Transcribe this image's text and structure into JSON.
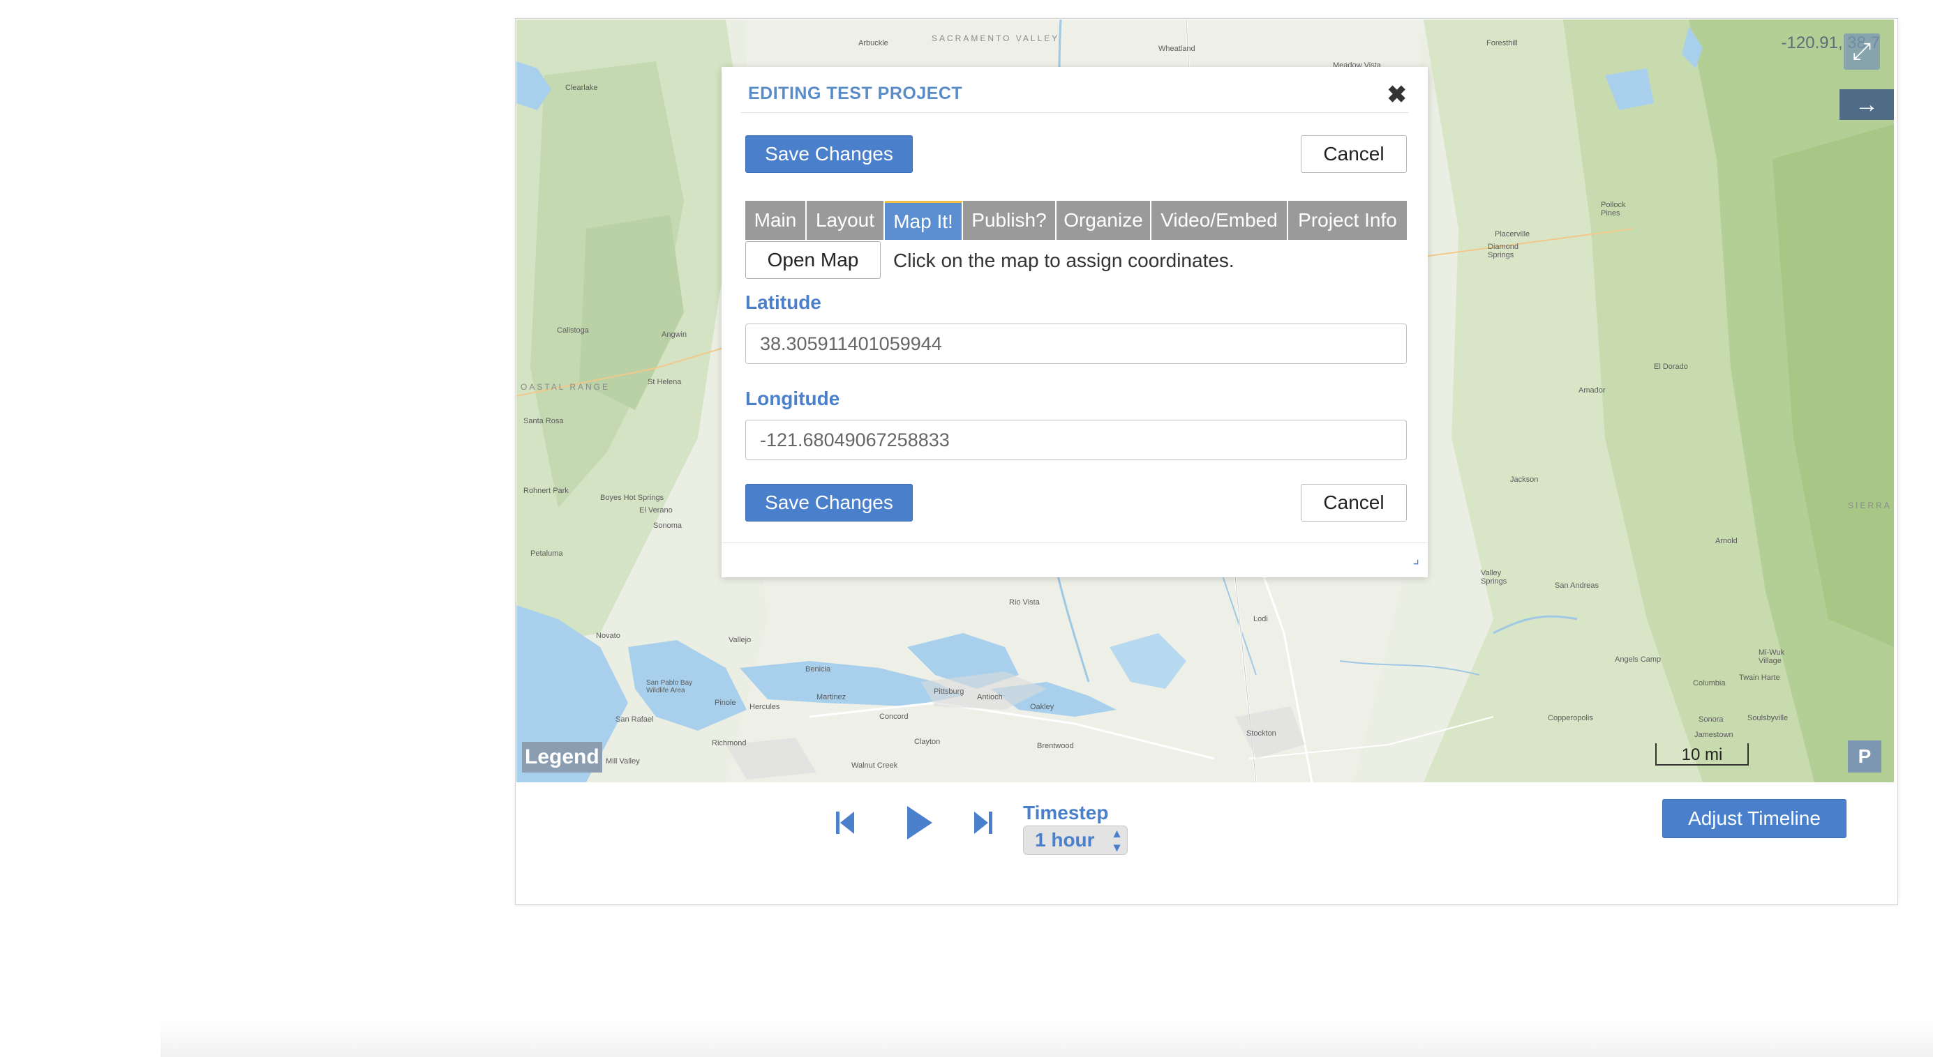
{
  "map": {
    "coordinate_readout": "-120.91, 38.7",
    "legend_label": "Legend",
    "p_label": "P",
    "scale_label": "10 mi",
    "labels": {
      "sacramento_valley": "SACRAMENTO VALLEY",
      "coast_range": "OASTAL RANGE",
      "arbuckle": "Arbuckle",
      "wheatland": "Wheatland",
      "foresthill": "Foresthill",
      "clearlake": "Clearlake",
      "meadow_vista": "Meadow Vista",
      "calistoga": "Calistoga",
      "angwin": "Angwin",
      "st_helena": "St Helena",
      "santa_rosa": "Santa Rosa",
      "rohnert_park": "Rohnert Park",
      "boyes_hot_springs": "Boyes Hot Springs",
      "el_verano": "El Verano",
      "sonoma": "Sonoma",
      "petaluma": "Petaluma",
      "novato": "Novato",
      "vallejo": "Vallejo",
      "benicia": "Benicia",
      "san_pablo_bay": "San Pablo Bay Wildlife Area",
      "pinole": "Pinole",
      "hercules": "Hercules",
      "martinez": "Martinez",
      "concord": "Concord",
      "pittsburg": "Pittsburg",
      "antioch": "Antioch",
      "oakley": "Oakley",
      "brentwood": "Brentwood",
      "clayton": "Clayton",
      "richmond": "Richmond",
      "san_rafael": "San Rafael",
      "mill_valley": "Mill Valley",
      "walnut_creek": "Walnut Creek",
      "rio_vista": "Rio Vista",
      "lodi": "Lodi",
      "stockton": "Stockton",
      "placerville": "Placerville",
      "diamond_springs": "Diamond Springs",
      "pollock_pines": "Pollock Pines",
      "el_dorado": "El Dorado",
      "amador": "Amador",
      "jackson": "Jackson",
      "valley_springs": "Valley Springs",
      "san_andreas": "San Andreas",
      "angels_camp": "Angels Camp",
      "copperopolis": "Copperopolis",
      "sonora": "Sonora",
      "columbia": "Columbia",
      "twain_harte": "Twain Harte",
      "jamestown": "Jamestown",
      "arnold": "Arnold",
      "sierra": "SIERRA",
      "mi_wuk_village": "Mi-Wuk Village",
      "soulsbyville": "Soulsbyville"
    }
  },
  "modal": {
    "title": "EDITING TEST PROJECT",
    "close_glyph": "✖",
    "save_label": "Save Changes",
    "cancel_label": "Cancel",
    "tabs": [
      {
        "label": "Main"
      },
      {
        "label": "Layout"
      },
      {
        "label": "Map It!"
      },
      {
        "label": "Publish?"
      },
      {
        "label": "Organize"
      },
      {
        "label": "Video/Embed"
      },
      {
        "label": "Project Info"
      }
    ],
    "active_tab": "Map It!",
    "open_map_label": "Open Map",
    "hint": "Click on the map to assign coordinates.",
    "latitude_label": "Latitude",
    "latitude_value": "38.305911401059944",
    "longitude_label": "Longitude",
    "longitude_value": "-121.68049067258833"
  },
  "timeline": {
    "timestep_label": "Timestep",
    "timestep_value": "1 hour",
    "adjust_label": "Adjust Timeline"
  },
  "colors": {
    "accent": "#4a7fcb",
    "tab_bg": "#9a9a9a",
    "tab_active": "#5b8fd1"
  },
  "icons": {
    "fullscreen": "expand-icon",
    "arrow": "arrow-right-icon",
    "first": "skip-first-icon",
    "play": "play-icon",
    "last": "skip-last-icon"
  }
}
